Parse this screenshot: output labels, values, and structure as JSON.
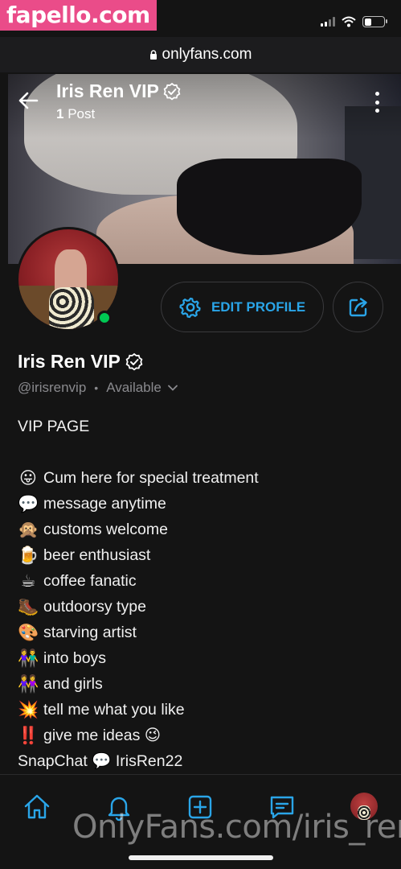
{
  "watermark": {
    "top": "fapello.com",
    "bottom": "OnlyFans.com/iris_ren"
  },
  "browser": {
    "url": "onlyfans.com",
    "lock_icon": "lock-icon"
  },
  "colors": {
    "accent": "#2aa5e8",
    "online": "#00c853",
    "background": "#141414",
    "watermark_bg": "#ea4c89"
  },
  "header": {
    "title": "Iris Ren VIP",
    "post_count": "1",
    "post_label": "Post"
  },
  "profile": {
    "name": "Iris Ren VIP",
    "handle": "@irisrenvip",
    "separator": "•",
    "availability": "Available",
    "edit_label": "EDIT PROFILE"
  },
  "bio": [
    {
      "emoji": "",
      "text": "VIP PAGE"
    },
    {
      "emoji": "",
      "text": ""
    },
    {
      "emoji": "😛",
      "text": "Cum here for special treatment"
    },
    {
      "emoji": "💬",
      "text": "message anytime"
    },
    {
      "emoji": "🙊",
      "text": "customs welcome"
    },
    {
      "emoji": "🍺",
      "text": "beer enthusiast"
    },
    {
      "emoji": "☕",
      "text": "coffee fanatic"
    },
    {
      "emoji": "🥾",
      "text": "outdoorsy type"
    },
    {
      "emoji": "🎨",
      "text": "starving artist"
    },
    {
      "emoji": "👫",
      "text": "into boys"
    },
    {
      "emoji": "👭",
      "text": "and girls"
    },
    {
      "emoji": "💥",
      "text": "tell me what you like"
    },
    {
      "emoji": "‼️",
      "text": "give me ideas 😉"
    },
    {
      "emoji": "",
      "text": "SnapChat 💬 IrisRen22"
    }
  ],
  "nav": [
    "home-icon",
    "bell-icon",
    "add-post-icon",
    "messages-icon",
    "profile-avatar"
  ]
}
